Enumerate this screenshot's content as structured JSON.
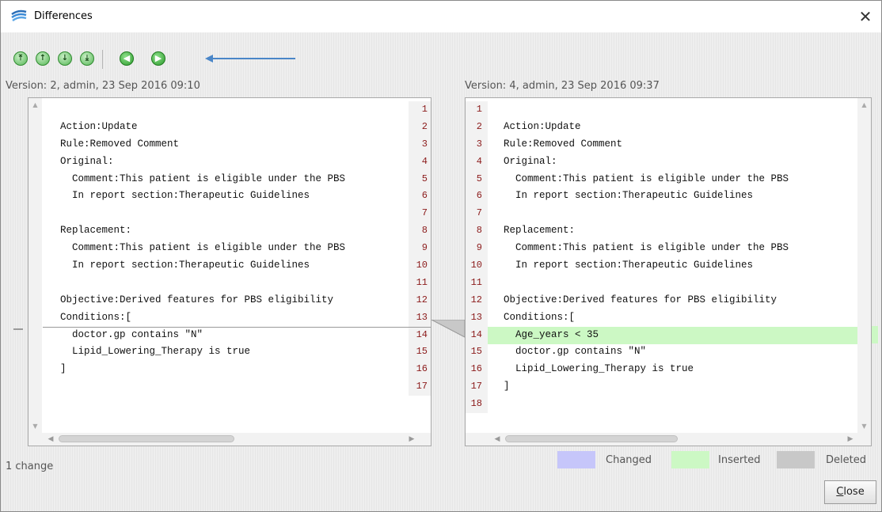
{
  "window": {
    "title": "Differences",
    "close_glyph": "✕"
  },
  "toolbar": {
    "buttons": [
      {
        "name": "first-change-button",
        "glyph": "⤒"
      },
      {
        "name": "previous-change-button",
        "glyph": "↑"
      },
      {
        "name": "next-change-button",
        "glyph": "↓"
      },
      {
        "name": "last-change-button",
        "glyph": "⤓"
      },
      {
        "name": "back-button",
        "glyph": "◀"
      },
      {
        "name": "forward-button",
        "glyph": "▶"
      }
    ],
    "annotation_color": "#4a86c8"
  },
  "left": {
    "version_label": "Version: 2, admin, 23 Sep 2016 09:10",
    "lines": [
      "",
      "Action:Update",
      "Rule:Removed Comment",
      "Original:",
      "  Comment:This patient is eligible under the PBS",
      "  In report section:Therapeutic Guidelines",
      "",
      "Replacement:",
      "  Comment:This patient is eligible under the PBS",
      "  In report section:Therapeutic Guidelines",
      "",
      "Objective:Derived features for PBS eligibility",
      "Conditions:[",
      "  doctor.gp contains \"N\"",
      "  Lipid_Lowering_Therapy is true",
      "]",
      ""
    ],
    "line_numbers": [
      "1",
      "2",
      "3",
      "4",
      "5",
      "6",
      "7",
      "8",
      "9",
      "10",
      "11",
      "12",
      "13",
      "14",
      "15",
      "16",
      "17"
    ]
  },
  "right": {
    "version_label": "Version: 4, admin, 23 Sep 2016 09:37",
    "lines": [
      "",
      "Action:Update",
      "Rule:Removed Comment",
      "Original:",
      "  Comment:This patient is eligible under the PBS",
      "  In report section:Therapeutic Guidelines",
      "",
      "Replacement:",
      "  Comment:This patient is eligible under the PBS",
      "  In report section:Therapeutic Guidelines",
      "",
      "Objective:Derived features for PBS eligibility",
      "Conditions:[",
      "  Age_years < 35",
      "  doctor.gp contains \"N\"",
      "  Lipid_Lowering_Therapy is true",
      "]",
      ""
    ],
    "line_numbers": [
      "1",
      "2",
      "3",
      "4",
      "5",
      "6",
      "7",
      "8",
      "9",
      "10",
      "11",
      "12",
      "13",
      "14",
      "15",
      "16",
      "17",
      "18"
    ],
    "inserted_line": 14
  },
  "footer": {
    "change_count": "1 change",
    "legend": [
      {
        "label": "Changed",
        "color": "#c6c6fa"
      },
      {
        "label": "Inserted",
        "color": "#ccf8c4"
      },
      {
        "label": "Deleted",
        "color": "#c8c8c8"
      }
    ],
    "close_label": "Close"
  }
}
